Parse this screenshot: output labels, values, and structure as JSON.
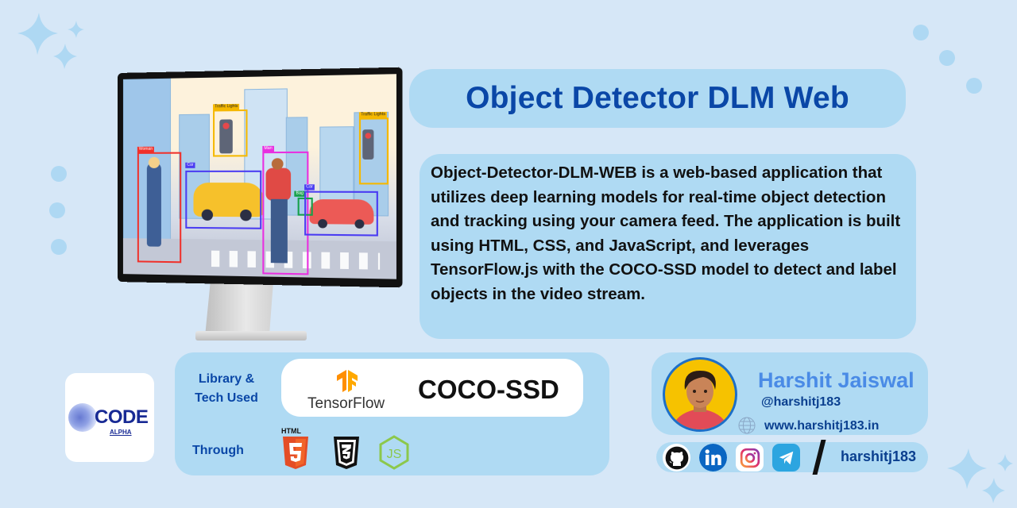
{
  "title": "Object Detector DLM Web",
  "description": "Object-Detector-DLM-WEB is a web-based application that utilizes deep learning models for real-time object detection and tracking using your camera feed. The application is built using HTML, CSS, and JavaScript, and leverages TensorFlow.js with the COCO-SSD model to detect and label objects in the video stream.",
  "monitor": {
    "detections": [
      {
        "label": "Woman",
        "color": "#f0302a"
      },
      {
        "label": "Car",
        "color": "#4a3cf2"
      },
      {
        "label": "Traffic Lights",
        "color": "#f5b800"
      },
      {
        "label": "Man",
        "color": "#e830e0"
      },
      {
        "label": "Bag",
        "color": "#15a04a"
      },
      {
        "label": "Car",
        "color": "#4a3cf2"
      },
      {
        "label": "Traffic Lights",
        "color": "#f5b800"
      }
    ]
  },
  "logo": {
    "line1": "CODE",
    "line2": "ALPHA"
  },
  "tech": {
    "library_label": "Library  &\nTech Used",
    "library_label_line1": "Library  &",
    "library_label_line2": "Tech Used",
    "tensorflow": "TensorFlow",
    "model": "COCO-SSD",
    "through_label": "Through",
    "html_label": "HTML",
    "icons": [
      "html5-icon",
      "css3-icon",
      "nodejs-icon"
    ]
  },
  "profile": {
    "name": "Harshit Jaiswal",
    "handle": "@harshitj183",
    "website": "www.harshitj183.in"
  },
  "social": {
    "icons": [
      "github-icon",
      "linkedin-icon",
      "instagram-icon",
      "telegram-icon"
    ],
    "handle": "harshitj183"
  },
  "colors": {
    "background": "#d6e7f7",
    "panel": "#afdaf3",
    "title": "#0a47a7",
    "name": "#4a8be6"
  }
}
